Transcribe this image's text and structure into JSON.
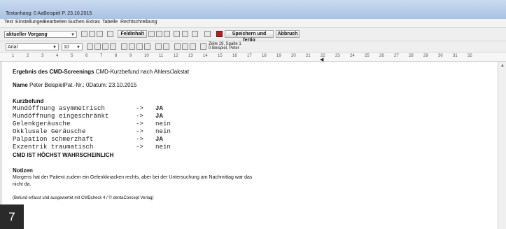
{
  "window": {
    "title": "Textanhang: 0 AaBeispiel P. 23.10.2015"
  },
  "menu": [
    "Text",
    "Einstellungen",
    "Bearbeiten",
    "Suchen",
    "Extras",
    "Tabelle",
    "Rechtschreibung"
  ],
  "toolbar": {
    "vorgang": "aktueller Vorgang",
    "feldinhalt_label": "Feldinhalt",
    "save_label": "Speichern und fertig",
    "cancel_label": "Abbruch"
  },
  "format": {
    "font": "Arial",
    "size": "10",
    "status_line1": "Zeile 19, Spalte 1",
    "status_line2": "0 Beispiel, Peter"
  },
  "ruler": [
    "1",
    "2",
    "3",
    "4",
    "5",
    "6",
    "7",
    "8",
    "9",
    "10",
    "11",
    "12",
    "13",
    "14",
    "15",
    "16",
    "17",
    "18",
    "19",
    "20",
    "21",
    "22",
    "23",
    "24",
    "25",
    "26",
    "27",
    "28",
    "29",
    "30",
    "31",
    "32"
  ],
  "doc": {
    "heading_bold": "Ergebnis des CMD-Screenings",
    "heading_rest": " CMD-Kurzbefund nach Ahlers/Jakstat",
    "name_label": "Name",
    "name_value": " Peter BeispielPat.-Nr.: 0Datum: 23.10.2015",
    "kurzbefund": "Kurzbefund",
    "findings": [
      {
        "label": "Mundöffnung asymmetrisch",
        "arrow": "->",
        "value": "JA"
      },
      {
        "label": "Mundöffnung eingeschränkt",
        "arrow": "->",
        "value": "JA"
      },
      {
        "label": "Gelenkgeräusche",
        "arrow": "->",
        "value": "nein"
      },
      {
        "label": "Okklusale Geräusche",
        "arrow": "->",
        "value": "nein"
      },
      {
        "label": "Palpation schmerzhaft",
        "arrow": "->",
        "value": "JA"
      },
      {
        "label": "Exzentrik traumatisch",
        "arrow": "->",
        "value": "nein"
      }
    ],
    "conclusion": "CMD IST HÖCHST WAHRSCHEINLICH",
    "notizen_label": "Notizen",
    "notes_line1": "Morgens hat der Patient zudem ein Gelenkknacken rechts, aber bei der Untersuchung am Nachmittag war das",
    "notes_line2": "nicht da.",
    "footer": "(Befund erfasst und ausgewertet mit CMDcheck 4 / © dentaConcept Verlag)"
  },
  "badge": "7"
}
